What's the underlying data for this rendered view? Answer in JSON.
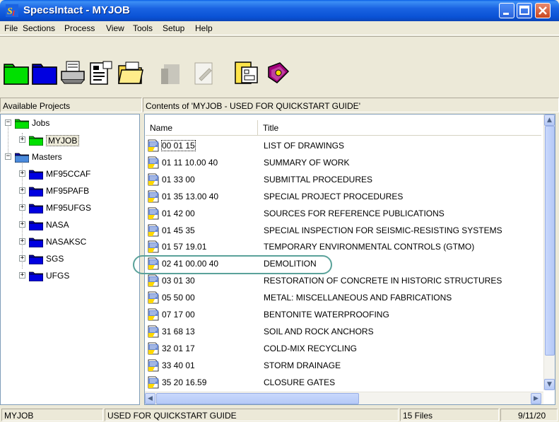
{
  "window": {
    "title": "SpecsIntact - MYJOB"
  },
  "menu": [
    "File",
    "Sections",
    "Process",
    "View",
    "Tools",
    "Setup",
    "Help"
  ],
  "toolbar": [
    "open-job-icon",
    "open-folder-icon",
    "print-icon",
    "properties-icon",
    "open-icon",
    "disabled-tool-icon",
    "disabled-edit-icon",
    "explorer-icon",
    "help-book-icon"
  ],
  "left_panel": {
    "header": "Available Projects",
    "tree": {
      "jobs_label": "Jobs",
      "jobs": [
        "MYJOB"
      ],
      "masters_label": "Masters",
      "masters": [
        "MF95CCAF",
        "MF95PAFB",
        "MF95UFGS",
        "NASA",
        "NASAKSC",
        "SGS",
        "UFGS"
      ]
    }
  },
  "right_panel": {
    "header": "Contents of 'MYJOB - USED FOR QUICKSTART GUIDE'",
    "columns": {
      "name": "Name",
      "title": "Title"
    },
    "rows": [
      {
        "name": "00 01 15",
        "title": "LIST OF DRAWINGS"
      },
      {
        "name": "01 11 10.00 40",
        "title": "SUMMARY OF WORK"
      },
      {
        "name": "01 33 00",
        "title": "SUBMITTAL PROCEDURES"
      },
      {
        "name": "01 35 13.00 40",
        "title": "SPECIAL PROJECT PROCEDURES"
      },
      {
        "name": "01 42 00",
        "title": "SOURCES FOR REFERENCE PUBLICATIONS"
      },
      {
        "name": "01 45 35",
        "title": "SPECIAL INSPECTION FOR SEISMIC-RESISTING SYSTEMS"
      },
      {
        "name": "01 57 19.01",
        "title": "TEMPORARY ENVIRONMENTAL CONTROLS (GTMO)"
      },
      {
        "name": "02 41 00.00 40",
        "title": "DEMOLITION"
      },
      {
        "name": "03 01 30",
        "title": "RESTORATION OF CONCRETE IN HISTORIC STRUCTURES"
      },
      {
        "name": "05 50 00",
        "title": "METAL: MISCELLANEOUS AND FABRICATIONS"
      },
      {
        "name": "07 17 00",
        "title": "BENTONITE WATERPROOFING"
      },
      {
        "name": "31 68 13",
        "title": "SOIL AND ROCK ANCHORS"
      },
      {
        "name": "32 01 17",
        "title": "COLD-MIX RECYCLING"
      },
      {
        "name": "33 40 01",
        "title": "STORM DRAINAGE"
      },
      {
        "name": "35 20 16.59",
        "title": "CLOSURE GATES"
      }
    ]
  },
  "statusbar": {
    "job": "MYJOB",
    "description": "USED FOR QUICKSTART GUIDE",
    "file_count": "15 Files",
    "date": "9/11/20"
  },
  "colors": {
    "titlebar": "#0a52d6",
    "highlight": "#5aa29a",
    "folder_green": "#00c000",
    "folder_blue": "#0000e0"
  }
}
